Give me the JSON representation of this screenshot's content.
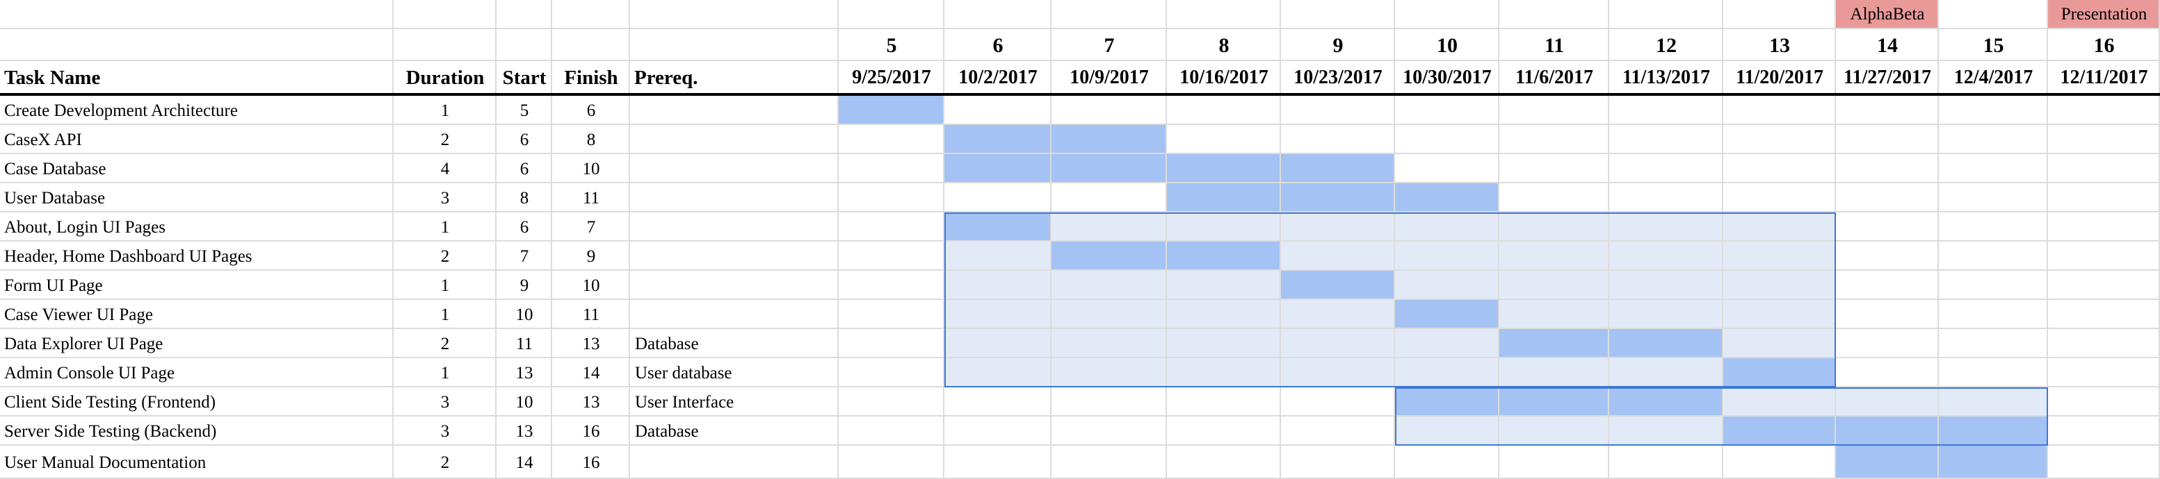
{
  "milestones": [
    {
      "week": 14,
      "label": "AlphaBeta"
    },
    {
      "week": 16,
      "label": "Presentation"
    }
  ],
  "headers": {
    "task_name": "Task Name",
    "duration": "Duration",
    "start": "Start",
    "finish": "Finish",
    "prereq": "Prereq."
  },
  "weeks": [
    {
      "num": "5",
      "date": "9/25/2017"
    },
    {
      "num": "6",
      "date": "10/2/2017"
    },
    {
      "num": "7",
      "date": "10/9/2017"
    },
    {
      "num": "8",
      "date": "10/16/2017"
    },
    {
      "num": "9",
      "date": "10/23/2017"
    },
    {
      "num": "10",
      "date": "10/30/2017"
    },
    {
      "num": "11",
      "date": "11/6/2017"
    },
    {
      "num": "12",
      "date": "11/13/2017"
    },
    {
      "num": "13",
      "date": "11/20/2017"
    },
    {
      "num": "14",
      "date": "11/27/2017"
    },
    {
      "num": "15",
      "date": "12/4/2017"
    },
    {
      "num": "16",
      "date": "12/11/2017"
    }
  ],
  "tasks": [
    {
      "name": "Create Development Architecture",
      "duration": "1",
      "start": "5",
      "finish": "6",
      "prereq": ""
    },
    {
      "name": "CaseX API",
      "duration": "2",
      "start": "6",
      "finish": "8",
      "prereq": ""
    },
    {
      "name": "Case Database",
      "duration": "4",
      "start": "6",
      "finish": "10",
      "prereq": ""
    },
    {
      "name": "User Database",
      "duration": "3",
      "start": "8",
      "finish": "11",
      "prereq": ""
    },
    {
      "name": "About, Login UI Pages",
      "duration": "1",
      "start": "6",
      "finish": "7",
      "prereq": ""
    },
    {
      "name": "Header, Home Dashboard UI Pages",
      "duration": "2",
      "start": "7",
      "finish": "9",
      "prereq": ""
    },
    {
      "name": "Form UI Page",
      "duration": "1",
      "start": "9",
      "finish": "10",
      "prereq": ""
    },
    {
      "name": "Case Viewer UI Page",
      "duration": "1",
      "start": "10",
      "finish": "11",
      "prereq": ""
    },
    {
      "name": "Data Explorer UI Page",
      "duration": "2",
      "start": "11",
      "finish": "13",
      "prereq": "Database"
    },
    {
      "name": "Admin Console UI Page",
      "duration": "1",
      "start": "13",
      "finish": "14",
      "prereq": "User database"
    },
    {
      "name": "Client Side Testing (Frontend)",
      "duration": "3",
      "start": "10",
      "finish": "13",
      "prereq": "User Interface"
    },
    {
      "name": "Server Side Testing (Backend)",
      "duration": "3",
      "start": "13",
      "finish": "16",
      "prereq": "Database"
    },
    {
      "name": "User Manual Documentation",
      "duration": "2",
      "start": "14",
      "finish": "16",
      "prereq": ""
    }
  ],
  "groups": [
    {
      "first_task": 4,
      "last_task": 9,
      "from_week": 6,
      "to_week": 14
    },
    {
      "first_task": 10,
      "last_task": 11,
      "from_week": 10,
      "to_week": 16
    }
  ],
  "colors": {
    "task_fill": "#a4c2f4",
    "group_fill": "#e3eaf7",
    "group_border": "#3c78d8",
    "milestone_fill": "#ea9999",
    "gridline": "#dcdcdc"
  }
}
